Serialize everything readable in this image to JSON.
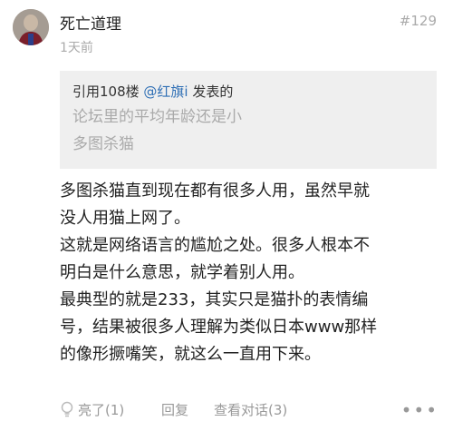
{
  "post": {
    "username": "死亡道理",
    "floor": "#129",
    "timestamp": "1天前",
    "quote": {
      "prefix": "引用108楼 ",
      "mention": "@红旗i",
      "suffix": " 发表的",
      "lines": [
        "论坛里的平均年龄还是小",
        "多图杀猫"
      ]
    },
    "content_lines": [
      "多图杀猫直到现在都有很多人用，虽然早就",
      "没人用猫上网了。",
      "这就是网络语言的尴尬之处。很多人根本不",
      "明白是什么意思，就学着别人用。",
      "最典型的就是233，其实只是猫扑的表情编",
      "号，结果被很多人理解为类似日本www那样",
      "的像形撅嘴笑，就这么一直用下来。"
    ],
    "actions": {
      "like": "亮了(1)",
      "reply": "回复",
      "conversation": "查看对话(3)",
      "more_icon": "more-dots-icon"
    }
  }
}
